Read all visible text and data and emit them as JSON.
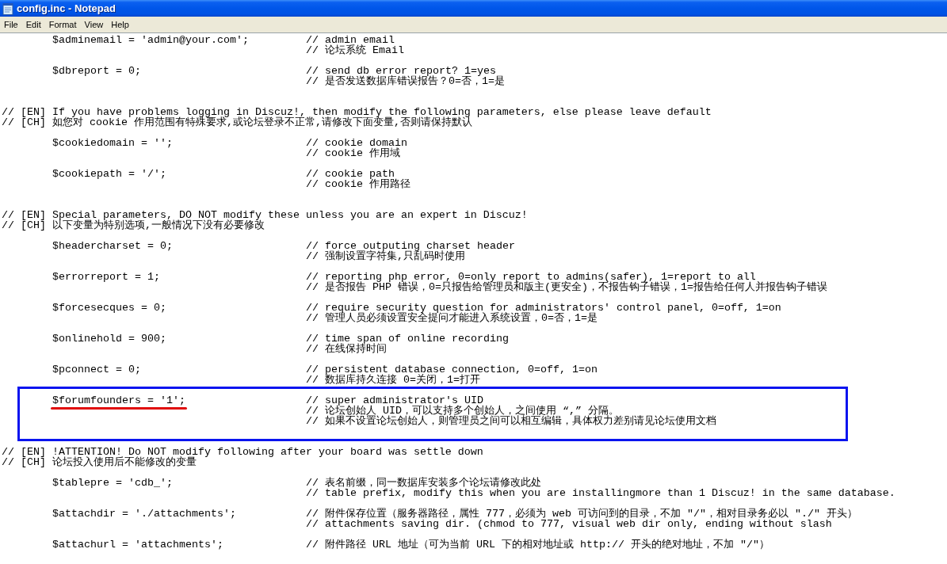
{
  "window": {
    "title": "config.inc - Notepad"
  },
  "menu": [
    "File",
    "Edit",
    "Format",
    "View",
    "Help"
  ],
  "editor": {
    "blocks": [
      {
        "kind": "setting",
        "code": "$adminemail = 'admin@your.com';",
        "comments": [
          "// admin email",
          "// 论坛系统 Email"
        ],
        "highlighted": false
      },
      {
        "kind": "setting",
        "code": "$dbreport = 0;",
        "comments": [
          "// send db error report? 1=yes",
          "// 是否发送数据库错误报告？0=否，1=是"
        ],
        "highlighted": false
      },
      {
        "kind": "section",
        "lines": [
          "// [EN] If you have problems logging in Discuz!, then modify the following parameters, else please leave default",
          "// [CH] 如您对 cookie 作用范围有特殊要求,或论坛登录不正常,请修改下面变量,否则请保持默认"
        ]
      },
      {
        "kind": "setting",
        "code": "$cookiedomain = '';",
        "comments": [
          "// cookie domain",
          "// cookie 作用域"
        ],
        "highlighted": false
      },
      {
        "kind": "setting",
        "code": "$cookiepath = '/';",
        "comments": [
          "// cookie path",
          "// cookie 作用路径"
        ],
        "highlighted": false
      },
      {
        "kind": "section",
        "lines": [
          "// [EN] Special parameters, DO NOT modify these unless you are an expert in Discuz!",
          "// [CH] 以下变量为特别选项,一般情况下没有必要修改"
        ]
      },
      {
        "kind": "setting",
        "code": "$headercharset = 0;",
        "comments": [
          "// force outputing charset header",
          "// 强制设置字符集,只乱码时使用"
        ],
        "highlighted": false
      },
      {
        "kind": "setting",
        "code": "$errorreport = 1;",
        "comments": [
          "// reporting php error, 0=only report to admins(safer), 1=report to all",
          "// 是否报告 PHP 错误，0=只报告给管理员和版主(更安全)，不报告钩子错误，1=报告给任何人并报告钩子错误"
        ],
        "highlighted": false
      },
      {
        "kind": "setting",
        "code": "$forcesecques = 0;",
        "comments": [
          "// require security question for administrators' control panel, 0=off, 1=on",
          "// 管理人员必须设置安全提问才能进入系统设置，0=否，1=是"
        ],
        "highlighted": false
      },
      {
        "kind": "setting",
        "code": "$onlinehold = 900;",
        "comments": [
          "// time span of online recording",
          "// 在线保持时间"
        ],
        "highlighted": false
      },
      {
        "kind": "setting",
        "code": "$pconnect = 0;",
        "comments": [
          "// persistent database connection, 0=off, 1=on",
          "// 数据库持久连接 0=关闭，1=打开"
        ],
        "highlighted": false
      },
      {
        "kind": "setting",
        "code": "$forumfounders = '1';",
        "comments": [
          "// super administrator's UID",
          "// 论坛创始人 UID，可以支持多个创始人，之间使用 “,” 分隔。",
          "// 如果不设置论坛创始人，则管理员之间可以相互编辑，具体权力差别请见论坛使用文档"
        ],
        "highlighted": true
      },
      {
        "kind": "section",
        "lines": [
          "// [EN] !ATTENTION! Do NOT modify following after your board was settle down",
          "// [CH] 论坛投入使用后不能修改的变量"
        ]
      },
      {
        "kind": "setting",
        "code": "$tablepre = 'cdb_';",
        "comments": [
          "// 表名前缀，同一数据库安装多个论坛请修改此处",
          "// table prefix, modify this when you are installingmore than 1 Discuz! in the same database."
        ],
        "highlighted": false
      },
      {
        "kind": "setting",
        "code": "$attachdir = './attachments';",
        "comments": [
          "// 附件保存位置（服务器路径，属性 777，必须为 web 可访问到的目录，不加 \"/\"，相对目录务必以 \"./\" 开头）",
          "// attachments saving dir. (chmod to 777, visual web dir only, ending without slash"
        ],
        "highlighted": false
      },
      {
        "kind": "setting",
        "code": "$attachurl = 'attachments';",
        "comments": [
          "// 附件路径 URL 地址（可为当前 URL 下的相对地址或 http:// 开头的绝对地址，不加 \"/\"）"
        ],
        "highlighted": false
      }
    ]
  }
}
